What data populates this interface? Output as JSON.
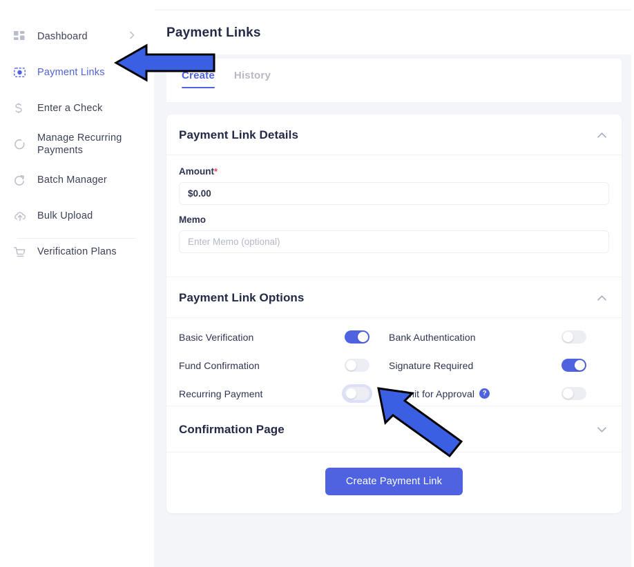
{
  "sidebar": {
    "items": [
      {
        "label": "Dashboard",
        "icon": "grid-icon",
        "active": false,
        "has_chevron": true
      },
      {
        "label": "Payment Links",
        "icon": "payment-link-icon",
        "active": true,
        "has_chevron": false
      },
      {
        "label": "Enter a Check",
        "icon": "dollar-icon",
        "active": false,
        "has_chevron": false
      },
      {
        "label": "Manage Recurring\nPayments",
        "icon": "recurring-circle-icon",
        "active": false,
        "has_chevron": false
      },
      {
        "label": "Batch Manager",
        "icon": "refresh-icon",
        "active": false,
        "has_chevron": false
      },
      {
        "label": "Bulk Upload",
        "icon": "cloud-upload-icon",
        "active": false,
        "has_chevron": false
      },
      {
        "label": "Verification Plans",
        "icon": "cart-icon",
        "active": false,
        "has_chevron": false
      }
    ]
  },
  "header": {
    "title": "Payment Links"
  },
  "tabs": [
    {
      "label": "Create",
      "active": true
    },
    {
      "label": "History",
      "active": false
    }
  ],
  "details_section": {
    "title": "Payment Link Details",
    "collapse_icon": "chevron-up-icon",
    "amount": {
      "label": "Amount",
      "required_mark": "*",
      "value": "$0.00"
    },
    "memo": {
      "label": "Memo",
      "placeholder": "Enter Memo (optional)",
      "value": ""
    }
  },
  "options_section": {
    "title": "Payment Link Options",
    "collapse_icon": "chevron-up-icon",
    "toggles": [
      {
        "label": "Basic Verification",
        "on": true,
        "focused": false,
        "help": false
      },
      {
        "label": "Bank Authentication",
        "on": false,
        "focused": false,
        "help": false
      },
      {
        "label": "Fund Confirmation",
        "on": false,
        "focused": false,
        "help": false
      },
      {
        "label": "Signature Required",
        "on": true,
        "focused": false,
        "help": false
      },
      {
        "label": "Recurring Payment",
        "on": false,
        "focused": true,
        "help": false
      },
      {
        "label": "Submit for Approval",
        "on": false,
        "focused": false,
        "help": true,
        "help_glyph": "?"
      }
    ]
  },
  "confirmation_section": {
    "title": "Confirmation Page",
    "collapse_icon": "chevron-down-icon"
  },
  "submit": {
    "label": "Create Payment Link"
  },
  "colors": {
    "accent": "#4f63e0",
    "annotation_arrow": "#3b5fe2",
    "toggle_off": "#eceef3",
    "required_red": "#f0425f",
    "page_bg": "#f4f5f8",
    "text_dark": "#222a46"
  },
  "annotations": [
    {
      "name": "arrow-pointing-to-payment-links",
      "direction": "left"
    },
    {
      "name": "arrow-pointing-to-recurring-payment-toggle",
      "direction": "up-left"
    }
  ]
}
